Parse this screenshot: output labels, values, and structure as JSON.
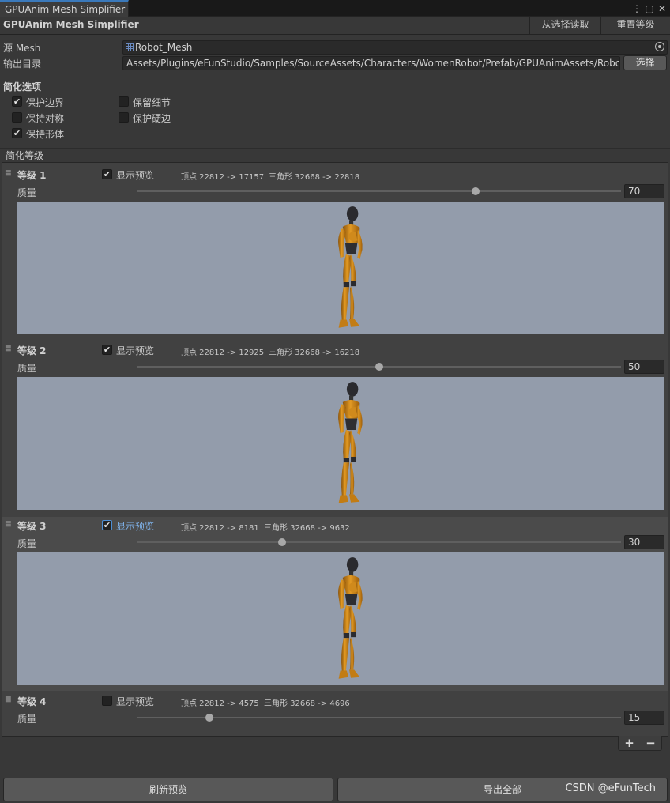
{
  "window": {
    "tab_title": "GPUAnim Mesh Simplifier",
    "menu_icon": "⋮",
    "maximize_icon": "▢",
    "close_icon": "✕"
  },
  "header": {
    "title": "GPUAnim Mesh Simplifier",
    "read_selection_button": "从选择读取",
    "reset_levels_button": "重置等级"
  },
  "source": {
    "source_mesh_label": "源 Mesh",
    "source_mesh_value": "Robot_Mesh",
    "output_dir_label": "输出目录",
    "output_dir_value": "Assets/Plugins/eFunStudio/Samples/SourceAssets/Characters/WomenRobot/Prefab/GPUAnimAssets/Robot",
    "choose_button": "选择"
  },
  "options": {
    "title": "简化选项",
    "items": [
      {
        "label": "保护边界",
        "checked": true
      },
      {
        "label": "保留细节",
        "checked": false
      },
      {
        "label": "保持对称",
        "checked": false
      },
      {
        "label": "保护硬边",
        "checked": false
      },
      {
        "label": "保持形体",
        "checked": true
      }
    ]
  },
  "levels_section": {
    "title": "简化等级",
    "quality_label": "质量",
    "preview_label": "显示预览",
    "levels": [
      {
        "name": "等级 1",
        "preview": true,
        "verts": "顶点 22812 -> 17157",
        "tris": "三角形 32668 -> 22818",
        "quality": 70,
        "quality_text": "70"
      },
      {
        "name": "等级 2",
        "preview": true,
        "verts": "顶点 22812 -> 12925",
        "tris": "三角形 32668 -> 16218",
        "quality": 50,
        "quality_text": "50"
      },
      {
        "name": "等级 3",
        "preview": true,
        "verts": "顶点 22812 -> 8181",
        "tris": "三角形 32668 -> 9632",
        "quality": 30,
        "quality_text": "30"
      },
      {
        "name": "等级 4",
        "preview": false,
        "verts": "顶点 22812 -> 4575",
        "tris": "三角形 32668 -> 4696",
        "quality": 15,
        "quality_text": "15"
      }
    ],
    "add_button": "+",
    "remove_button": "−"
  },
  "footer": {
    "refresh_button": "刷新预览",
    "export_button": "导出全部",
    "watermark": "CSDN @eFunTech"
  },
  "colors": {
    "accent": "#3a79bb",
    "preview_bg": "#939cab",
    "robot": "#d68a1a"
  }
}
